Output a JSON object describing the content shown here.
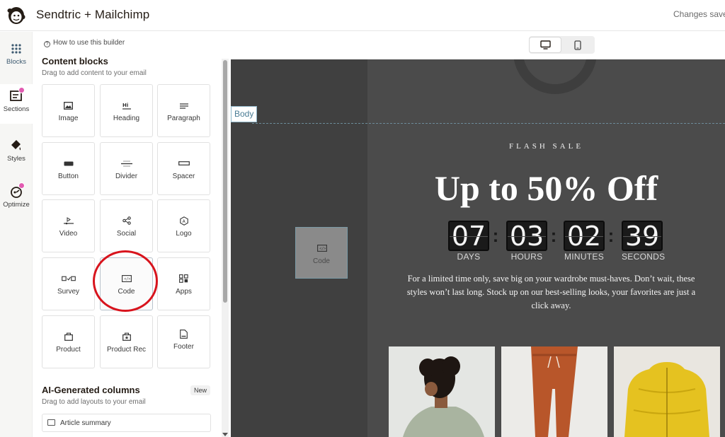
{
  "header": {
    "title": "Sendtric + Mailchimp",
    "save_status": "Changes save"
  },
  "rail": {
    "items": [
      {
        "label": "Blocks",
        "icon": "grid-dots-icon",
        "active": false
      },
      {
        "label": "Sections",
        "icon": "sections-icon",
        "active": true,
        "has_dot": true
      },
      {
        "label": "Styles",
        "icon": "paint-bucket-icon",
        "active": false
      },
      {
        "label": "Optimize",
        "icon": "optimize-icon",
        "active": false,
        "has_dot": true
      }
    ]
  },
  "panel": {
    "help_link": "How to use this builder",
    "content_blocks": {
      "title": "Content blocks",
      "subtitle": "Drag to add content to your email",
      "tiles": [
        {
          "label": "Image",
          "icon": "image-icon"
        },
        {
          "label": "Heading",
          "icon": "heading-icon"
        },
        {
          "label": "Paragraph",
          "icon": "paragraph-icon"
        },
        {
          "label": "Button",
          "icon": "button-icon"
        },
        {
          "label": "Divider",
          "icon": "divider-icon"
        },
        {
          "label": "Spacer",
          "icon": "spacer-icon"
        },
        {
          "label": "Video",
          "icon": "video-icon"
        },
        {
          "label": "Social",
          "icon": "share-icon"
        },
        {
          "label": "Logo",
          "icon": "logo-icon"
        },
        {
          "label": "Survey",
          "icon": "survey-icon"
        },
        {
          "label": "Code",
          "icon": "code-icon",
          "selected": true
        },
        {
          "label": "Apps",
          "icon": "apps-icon"
        },
        {
          "label": "Product",
          "icon": "bag-icon"
        },
        {
          "label": "Product Rec",
          "icon": "bag-star-icon"
        },
        {
          "label": "Footer",
          "icon": "footer-icon"
        }
      ]
    },
    "ai_columns": {
      "title": "AI-Generated columns",
      "badge": "New",
      "subtitle": "Drag to add layouts to your email",
      "first_item": "Article summary"
    }
  },
  "canvas": {
    "body_label": "Body",
    "drag_ghost_label": "Code",
    "email": {
      "eyebrow": "FLASH SALE",
      "headline": "Up to 50% Off",
      "countdown": [
        {
          "value": "07",
          "unit": "DAYS"
        },
        {
          "value": "03",
          "unit": "HOURS"
        },
        {
          "value": "02",
          "unit": "MINUTES"
        },
        {
          "value": "39",
          "unit": "SECONDS"
        }
      ],
      "promo_text": "For a limited time only, save big on your wardrobe must-haves. Don’t wait, these styles won’t last long. Stock up on our best-selling looks, your favorites are just a click away.",
      "products": [
        "person-in-sweatshirt-photo",
        "rust-joggers-photo",
        "yellow-puffer-jacket-photo"
      ]
    }
  },
  "colors": {
    "annotation": "#d8141d",
    "canvas_bg": "#404040",
    "email_bg": "#4b4b4b",
    "rail_dot": "#e25bb1"
  }
}
